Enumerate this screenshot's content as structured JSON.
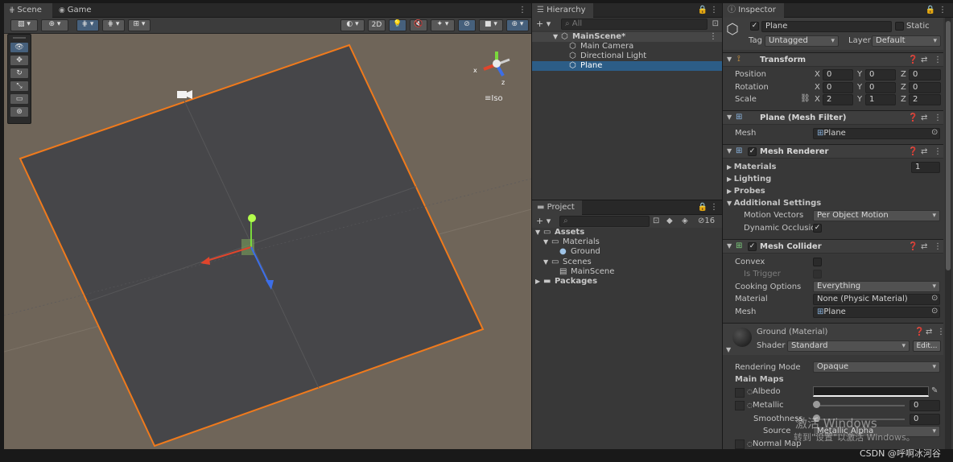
{
  "scene_panel": {
    "tabs": [
      "Scene",
      "Game"
    ],
    "two_d_label": "2D",
    "iso_label": "Iso",
    "gizmo_axes": {
      "x": "x",
      "z": "z"
    },
    "tools": [
      "view-tool",
      "move-tool",
      "rotate-tool",
      "scale-tool",
      "rect-tool",
      "transform-tool"
    ]
  },
  "hierarchy": {
    "tab": "Hierarchy",
    "search_placeholder": "All",
    "scene": "MainScene*",
    "items": [
      "Main Camera",
      "Directional Light",
      "Plane"
    ],
    "selected": "Plane"
  },
  "project": {
    "tab": "Project",
    "hidden_count": "16",
    "tree": {
      "assets": "Assets",
      "materials": "Materials",
      "ground": "Ground",
      "scenes": "Scenes",
      "mainscene": "MainScene",
      "packages": "Packages"
    }
  },
  "inspector": {
    "tab": "Inspector",
    "object_name": "Plane",
    "static_label": "Static",
    "tag_label": "Tag",
    "tag_value": "Untagged",
    "layer_label": "Layer",
    "layer_value": "Default",
    "transform": {
      "title": "Transform",
      "position_label": "Position",
      "rotation_label": "Rotation",
      "scale_label": "Scale",
      "axis": {
        "x": "X",
        "y": "Y",
        "z": "Z"
      },
      "position": {
        "x": "0",
        "y": "0",
        "z": "0"
      },
      "rotation": {
        "x": "0",
        "y": "0",
        "z": "0"
      },
      "scale": {
        "x": "2",
        "y": "1",
        "z": "2"
      }
    },
    "mesh_filter": {
      "title": "Plane (Mesh Filter)",
      "mesh_label": "Mesh",
      "mesh_value": "Plane"
    },
    "mesh_renderer": {
      "title": "Mesh Renderer",
      "materials_label": "Materials",
      "materials_count": "1",
      "lighting_label": "Lighting",
      "probes_label": "Probes",
      "additional_label": "Additional Settings",
      "motion_vectors_label": "Motion Vectors",
      "motion_vectors_value": "Per Object Motion",
      "dynamic_occlusion_label": "Dynamic Occlusion"
    },
    "mesh_collider": {
      "title": "Mesh Collider",
      "convex_label": "Convex",
      "is_trigger_label": "Is Trigger",
      "cooking_label": "Cooking Options",
      "cooking_value": "Everything",
      "material_label": "Material",
      "material_value": "None (Physic Material)",
      "mesh_label": "Mesh",
      "mesh_value": "Plane"
    },
    "material": {
      "title": "Ground (Material)",
      "shader_label": "Shader",
      "shader_value": "Standard",
      "edit_label": "Edit...",
      "rendering_mode_label": "Rendering Mode",
      "rendering_mode_value": "Opaque",
      "main_maps_label": "Main Maps",
      "albedo_label": "Albedo",
      "metallic_label": "Metallic",
      "metallic_value": "0",
      "smoothness_label": "Smoothness",
      "smoothness_value": "0",
      "source_label": "Source",
      "source_value": "Metallic Alpha",
      "normal_map_label": "Normal Map"
    }
  },
  "overlays": {
    "watermark_line1": "激活 Windows",
    "watermark_line2": "转到\"设置\"以激活 Windows。",
    "csdn": "CSDN @呼啊冰河谷"
  },
  "colors": {
    "selection": "#2c5d87",
    "scene_bg": "#6f6559",
    "plane": "#464649",
    "outline": "#f07a1c",
    "accent_blue": "#46607c"
  }
}
